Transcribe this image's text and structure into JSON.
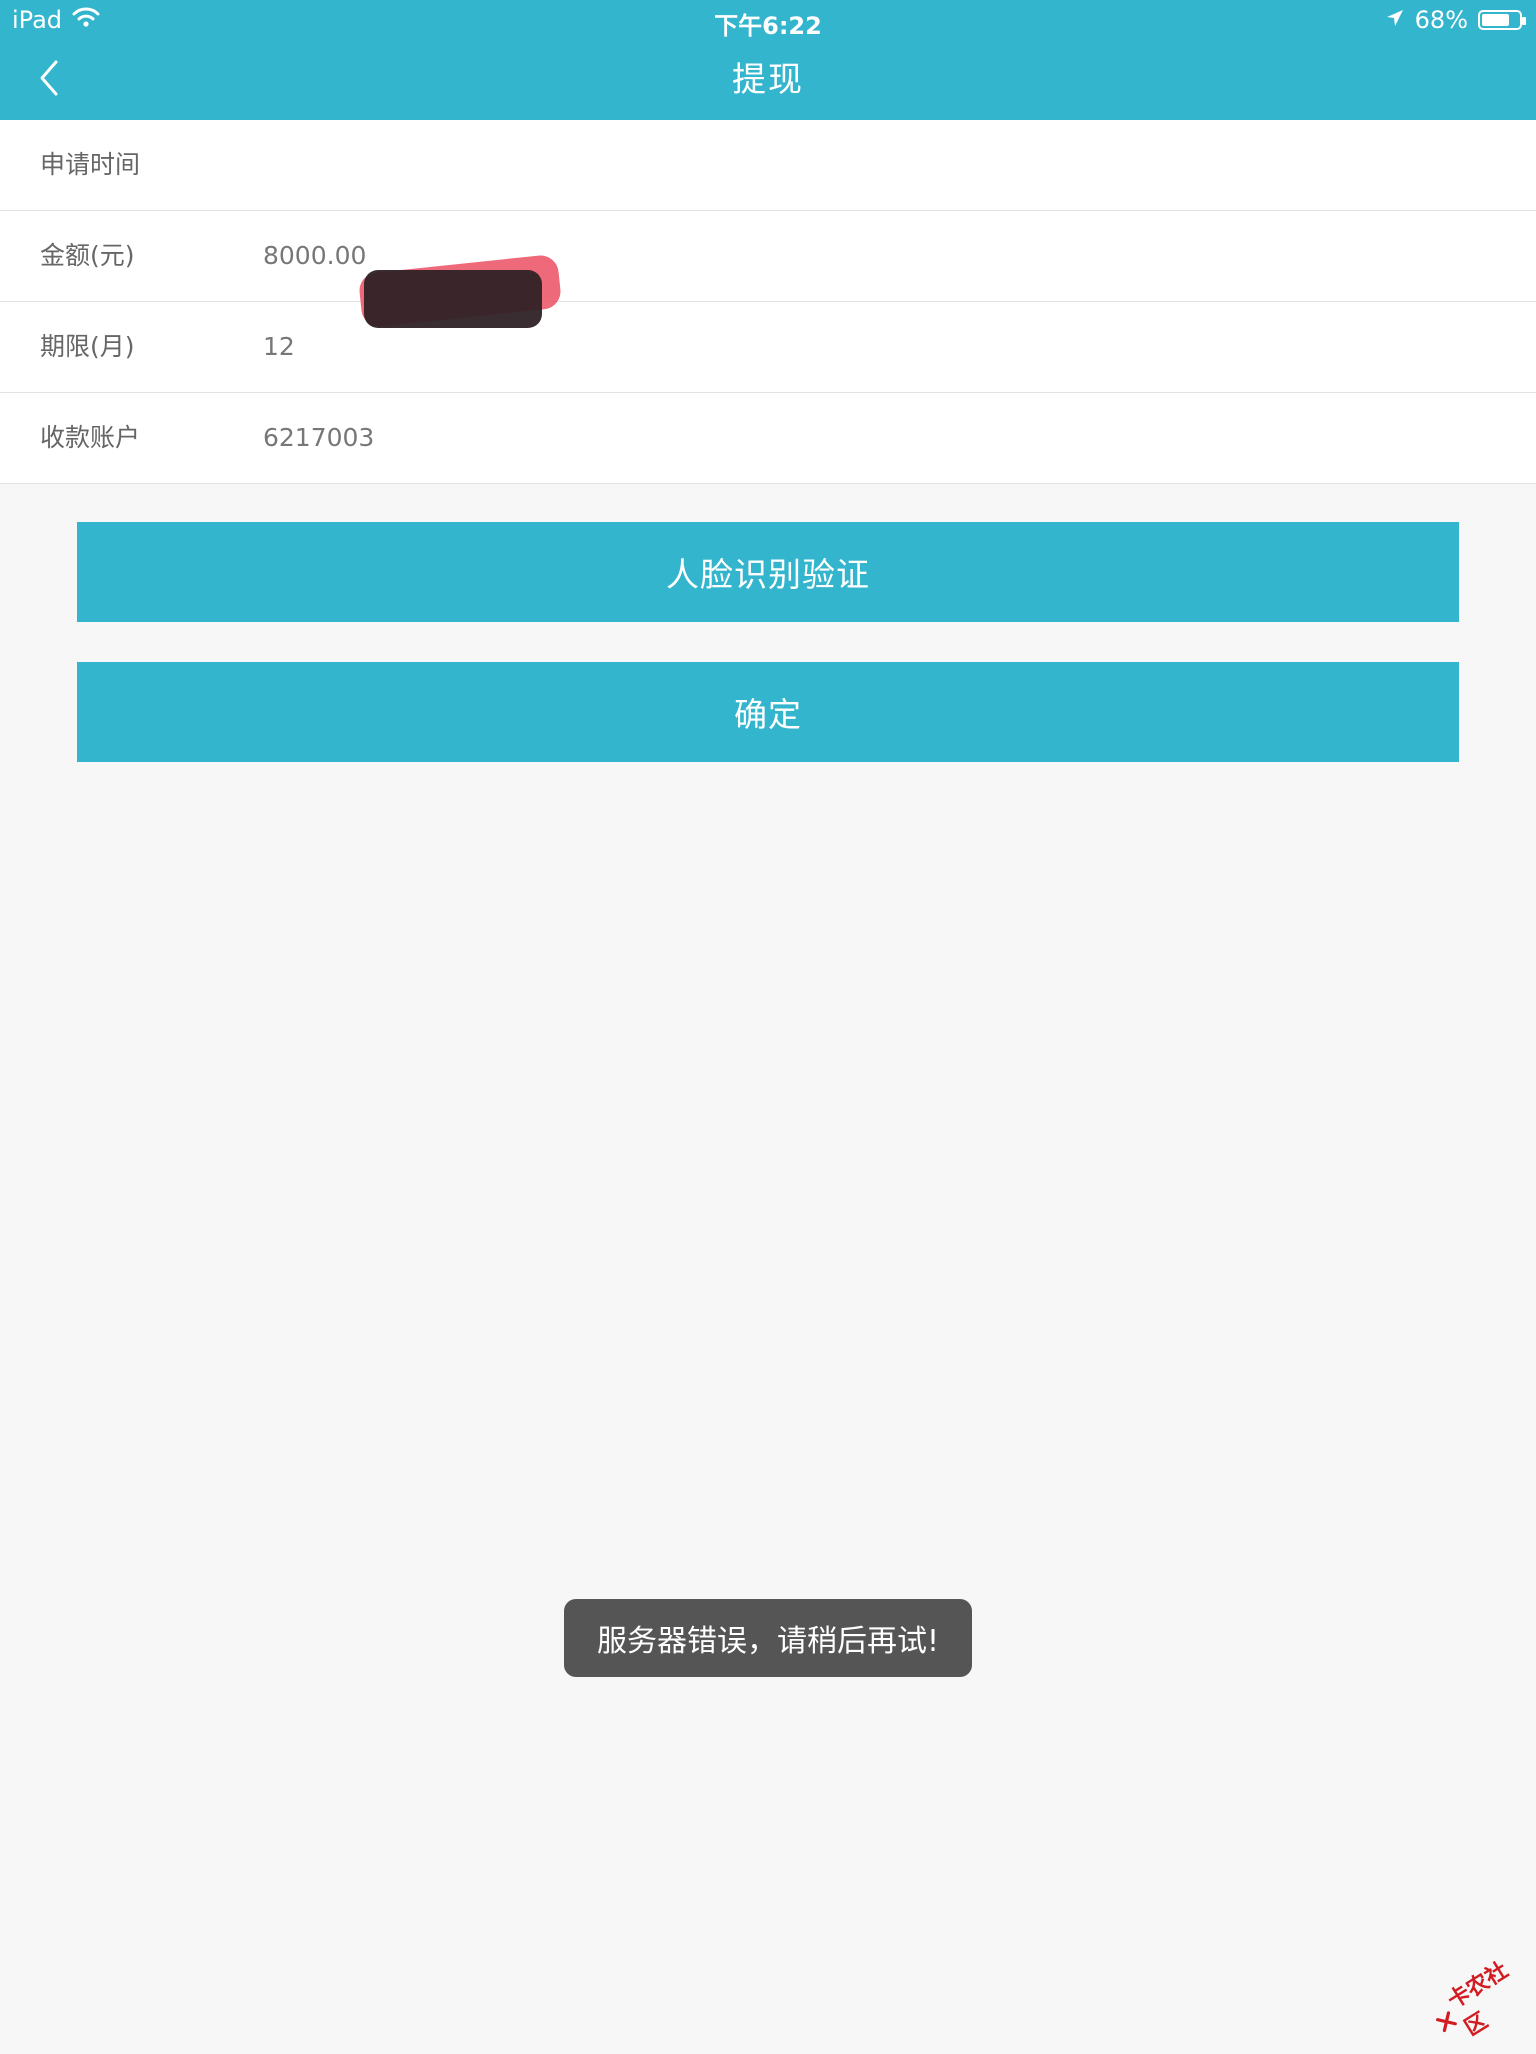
{
  "status_bar": {
    "device": "iPad",
    "time": "下午6:22",
    "battery": "68%"
  },
  "nav": {
    "title": "提现"
  },
  "rows": [
    {
      "label": "申请时间",
      "value": ""
    },
    {
      "label": "金额(元)",
      "value": "8000.00"
    },
    {
      "label": "期限(月)",
      "value": "12"
    },
    {
      "label": "收款账户",
      "value": "6217003"
    }
  ],
  "buttons": {
    "face_verify": "人脸识别验证",
    "confirm": "确定"
  },
  "toast": {
    "message": "服务器错误，请稍后再试!"
  },
  "watermark": {
    "text": "卡农社区"
  },
  "colors": {
    "primary": "#33b5cd",
    "background": "#f7f7f7",
    "toast": "#555555"
  }
}
